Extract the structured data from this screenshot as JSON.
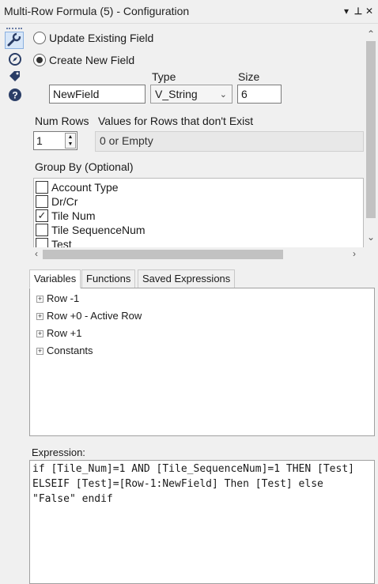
{
  "window": {
    "title": "Multi-Row Formula (5) - Configuration",
    "controls": {
      "menu": "▾",
      "pin": "⊥",
      "close": "✕"
    }
  },
  "sidebar": {
    "icons": [
      "wrench-icon",
      "compass-icon",
      "tag-icon",
      "help-icon"
    ]
  },
  "config": {
    "update_existing_label": "Update Existing Field",
    "create_new_label": "Create New  Field",
    "selected_mode": "create_new",
    "type_label": "Type",
    "size_label": "Size",
    "field_name_value": "NewField",
    "type_value": "V_String",
    "size_value": "6",
    "num_rows_label": "Num Rows",
    "num_rows_value": "1",
    "values_label": "Values for Rows that don't Exist",
    "values_value": "0 or Empty",
    "group_by_label": "Group By (Optional)",
    "group_by_items": [
      {
        "label": "Account Type",
        "checked": false
      },
      {
        "label": "Dr/Cr",
        "checked": false
      },
      {
        "label": "Tile  Num",
        "checked": true
      },
      {
        "label": "Tile  SequenceNum",
        "checked": false
      },
      {
        "label": "Test",
        "checked": false
      }
    ]
  },
  "tabs": [
    {
      "label": "Variables",
      "active": true
    },
    {
      "label": "Functions",
      "active": false
    },
    {
      "label": "Saved Expressions",
      "active": false
    }
  ],
  "variables": {
    "tree": [
      "Row -1",
      "Row +0 - Active Row",
      "Row +1",
      "Constants"
    ]
  },
  "expression": {
    "label": "Expression:",
    "text": "if [Tile_Num]=1 AND [Tile_SequenceNum]=1 THEN [Test]\nELSEIF [Test]=[Row-1:NewField] Then [Test] else\n\"False\" endif"
  }
}
